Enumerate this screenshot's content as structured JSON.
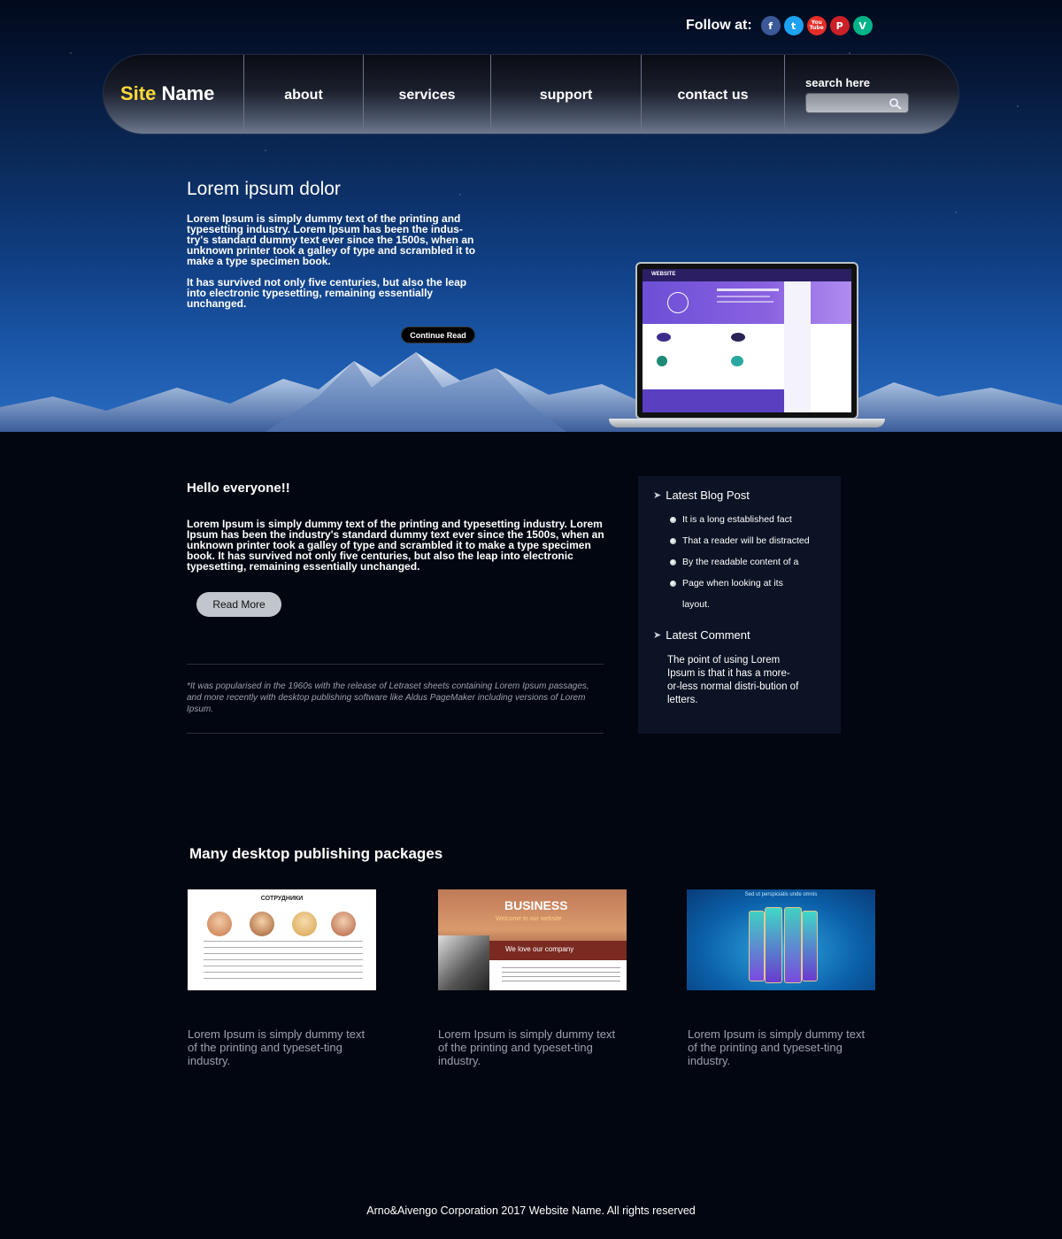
{
  "follow": {
    "label": "Follow at:",
    "icons": [
      {
        "name": "facebook-icon",
        "glyph": "f",
        "color": "#3b5998"
      },
      {
        "name": "twitter-icon",
        "glyph": "t",
        "color": "#1da1f2"
      },
      {
        "name": "youtube-icon",
        "glyph": "You Tube",
        "color": "#e52d27"
      },
      {
        "name": "pinterest-icon",
        "glyph": "P",
        "color": "#cb2027"
      },
      {
        "name": "vine-icon",
        "glyph": "V",
        "color": "#00b488"
      }
    ]
  },
  "nav": {
    "site_name_1": "Site",
    "site_name_2": "Name",
    "items": [
      "about",
      "services",
      "support",
      "contact us"
    ],
    "search_label": "search here",
    "search_placeholder": ""
  },
  "hero": {
    "title": "Lorem ipsum dolor",
    "p1": "Lorem Ipsum is simply dummy text of the printing and typesetting industry. Lorem Ipsum has been the indus-try's standard dummy text ever since the 1500s, when an unknown printer took a galley of type and scrambled it to make a type specimen book.",
    "p2": "It has survived not only five centuries, but also the leap into electronic typesetting, remaining essentially unchanged.",
    "button": "Continue Read",
    "screen_logo": "WEBSITE"
  },
  "intro": {
    "title": "Hello everyone!!",
    "text": "Lorem Ipsum is simply dummy text of the printing and typesetting industry. Lorem Ipsum has been the industry's standard dummy text ever since the 1500s, when an unknown printer took a galley of type and scrambled it to make a type specimen book. It has survived not only five centuries, but also the leap into electronic typesetting, remaining essentially unchanged.",
    "button": "Read More",
    "note": "*It was popularised in the 1960s with the release of Letraset sheets containing Lorem Ipsum passages, and more recently with desktop publishing software like Aldus PageMaker including versions of Lorem Ipsum."
  },
  "sidebar": {
    "blog_title": "Latest Blog Post",
    "blog_items": [
      "It is a long established fact",
      "That a reader will be distracted",
      "By the readable content of a",
      "Page when looking at its"
    ],
    "blog_item_cont": "layout.",
    "comment_title": "Latest Comment",
    "comment_text": "The point of using Lorem Ipsum is that it has a more-or-less normal distri-bution of letters."
  },
  "packages": {
    "title": "Many desktop publishing packages",
    "items": [
      {
        "text": "Lorem Ipsum is simply dummy text of the printing and typeset-ting industry.",
        "img_title": "СОТРУДНИКИ"
      },
      {
        "text": "Lorem Ipsum is simply dummy text of the printing and typeset-ting industry.",
        "img_title": "BUSINESS",
        "img_sub": "Welcome to our website",
        "img_band": "We love our company"
      },
      {
        "text": "Lorem Ipsum is simply dummy text of the printing and typeset-ting industry.",
        "img_title": "Sed ut perspiciatis unde omnis"
      }
    ]
  },
  "footer": {
    "text": "Arno&Aivengo Corporation 2017 Website Name. All rights reserved"
  }
}
